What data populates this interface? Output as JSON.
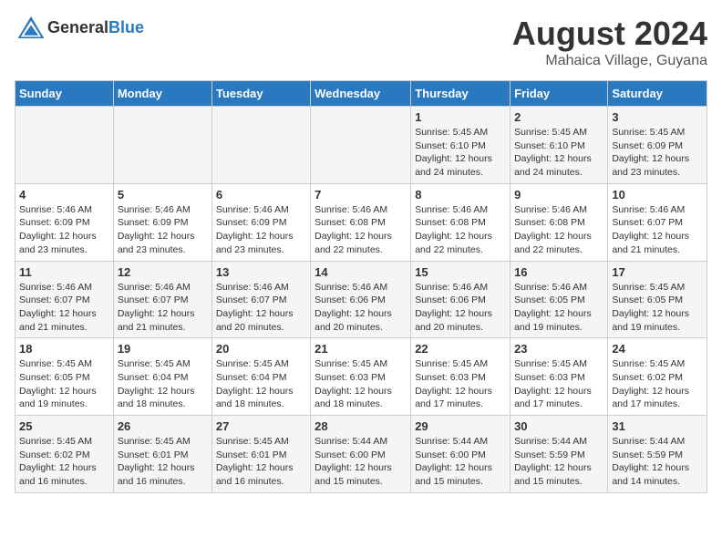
{
  "header": {
    "logo_general": "General",
    "logo_blue": "Blue",
    "main_title": "August 2024",
    "sub_title": "Mahaica Village, Guyana"
  },
  "days_of_week": [
    "Sunday",
    "Monday",
    "Tuesday",
    "Wednesday",
    "Thursday",
    "Friday",
    "Saturday"
  ],
  "weeks": [
    [
      {
        "day": "",
        "detail": ""
      },
      {
        "day": "",
        "detail": ""
      },
      {
        "day": "",
        "detail": ""
      },
      {
        "day": "",
        "detail": ""
      },
      {
        "day": "1",
        "detail": "Sunrise: 5:45 AM\nSunset: 6:10 PM\nDaylight: 12 hours\nand 24 minutes."
      },
      {
        "day": "2",
        "detail": "Sunrise: 5:45 AM\nSunset: 6:10 PM\nDaylight: 12 hours\nand 24 minutes."
      },
      {
        "day": "3",
        "detail": "Sunrise: 5:45 AM\nSunset: 6:09 PM\nDaylight: 12 hours\nand 23 minutes."
      }
    ],
    [
      {
        "day": "4",
        "detail": "Sunrise: 5:46 AM\nSunset: 6:09 PM\nDaylight: 12 hours\nand 23 minutes."
      },
      {
        "day": "5",
        "detail": "Sunrise: 5:46 AM\nSunset: 6:09 PM\nDaylight: 12 hours\nand 23 minutes."
      },
      {
        "day": "6",
        "detail": "Sunrise: 5:46 AM\nSunset: 6:09 PM\nDaylight: 12 hours\nand 23 minutes."
      },
      {
        "day": "7",
        "detail": "Sunrise: 5:46 AM\nSunset: 6:08 PM\nDaylight: 12 hours\nand 22 minutes."
      },
      {
        "day": "8",
        "detail": "Sunrise: 5:46 AM\nSunset: 6:08 PM\nDaylight: 12 hours\nand 22 minutes."
      },
      {
        "day": "9",
        "detail": "Sunrise: 5:46 AM\nSunset: 6:08 PM\nDaylight: 12 hours\nand 22 minutes."
      },
      {
        "day": "10",
        "detail": "Sunrise: 5:46 AM\nSunset: 6:07 PM\nDaylight: 12 hours\nand 21 minutes."
      }
    ],
    [
      {
        "day": "11",
        "detail": "Sunrise: 5:46 AM\nSunset: 6:07 PM\nDaylight: 12 hours\nand 21 minutes."
      },
      {
        "day": "12",
        "detail": "Sunrise: 5:46 AM\nSunset: 6:07 PM\nDaylight: 12 hours\nand 21 minutes."
      },
      {
        "day": "13",
        "detail": "Sunrise: 5:46 AM\nSunset: 6:07 PM\nDaylight: 12 hours\nand 20 minutes."
      },
      {
        "day": "14",
        "detail": "Sunrise: 5:46 AM\nSunset: 6:06 PM\nDaylight: 12 hours\nand 20 minutes."
      },
      {
        "day": "15",
        "detail": "Sunrise: 5:46 AM\nSunset: 6:06 PM\nDaylight: 12 hours\nand 20 minutes."
      },
      {
        "day": "16",
        "detail": "Sunrise: 5:46 AM\nSunset: 6:05 PM\nDaylight: 12 hours\nand 19 minutes."
      },
      {
        "day": "17",
        "detail": "Sunrise: 5:45 AM\nSunset: 6:05 PM\nDaylight: 12 hours\nand 19 minutes."
      }
    ],
    [
      {
        "day": "18",
        "detail": "Sunrise: 5:45 AM\nSunset: 6:05 PM\nDaylight: 12 hours\nand 19 minutes."
      },
      {
        "day": "19",
        "detail": "Sunrise: 5:45 AM\nSunset: 6:04 PM\nDaylight: 12 hours\nand 18 minutes."
      },
      {
        "day": "20",
        "detail": "Sunrise: 5:45 AM\nSunset: 6:04 PM\nDaylight: 12 hours\nand 18 minutes."
      },
      {
        "day": "21",
        "detail": "Sunrise: 5:45 AM\nSunset: 6:03 PM\nDaylight: 12 hours\nand 18 minutes."
      },
      {
        "day": "22",
        "detail": "Sunrise: 5:45 AM\nSunset: 6:03 PM\nDaylight: 12 hours\nand 17 minutes."
      },
      {
        "day": "23",
        "detail": "Sunrise: 5:45 AM\nSunset: 6:03 PM\nDaylight: 12 hours\nand 17 minutes."
      },
      {
        "day": "24",
        "detail": "Sunrise: 5:45 AM\nSunset: 6:02 PM\nDaylight: 12 hours\nand 17 minutes."
      }
    ],
    [
      {
        "day": "25",
        "detail": "Sunrise: 5:45 AM\nSunset: 6:02 PM\nDaylight: 12 hours\nand 16 minutes."
      },
      {
        "day": "26",
        "detail": "Sunrise: 5:45 AM\nSunset: 6:01 PM\nDaylight: 12 hours\nand 16 minutes."
      },
      {
        "day": "27",
        "detail": "Sunrise: 5:45 AM\nSunset: 6:01 PM\nDaylight: 12 hours\nand 16 minutes."
      },
      {
        "day": "28",
        "detail": "Sunrise: 5:44 AM\nSunset: 6:00 PM\nDaylight: 12 hours\nand 15 minutes."
      },
      {
        "day": "29",
        "detail": "Sunrise: 5:44 AM\nSunset: 6:00 PM\nDaylight: 12 hours\nand 15 minutes."
      },
      {
        "day": "30",
        "detail": "Sunrise: 5:44 AM\nSunset: 5:59 PM\nDaylight: 12 hours\nand 15 minutes."
      },
      {
        "day": "31",
        "detail": "Sunrise: 5:44 AM\nSunset: 5:59 PM\nDaylight: 12 hours\nand 14 minutes."
      }
    ]
  ]
}
